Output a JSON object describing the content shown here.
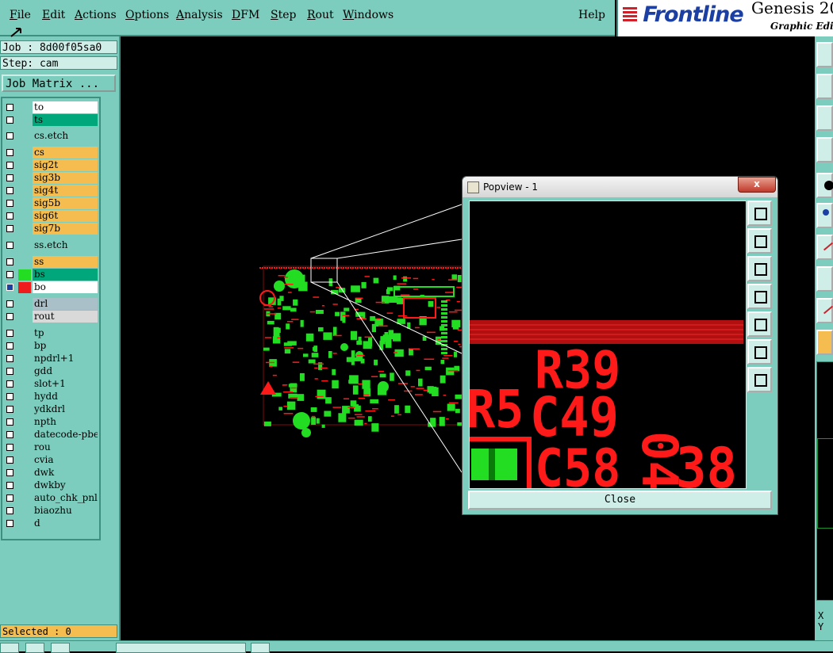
{
  "menu": {
    "items": [
      {
        "u": "F",
        "rest": "ile"
      },
      {
        "u": "E",
        "rest": "dit"
      },
      {
        "u": "A",
        "rest": "ctions"
      },
      {
        "u": "O",
        "rest": "ptions"
      },
      {
        "u": "A",
        "rest": "nalysis"
      },
      {
        "u": "D",
        "rest": "FM"
      },
      {
        "u": "S",
        "rest": "tep"
      },
      {
        "u": "R",
        "rest": "out"
      },
      {
        "u": "W",
        "rest": "indows"
      }
    ],
    "help": "Help"
  },
  "brand": {
    "logo": "Frontline",
    "product": "Genesis 20",
    "subtitle": "Graphic Edito"
  },
  "job": "Job : 8d00f05sa0",
  "step": "Step: cam",
  "job_matrix": "Job Matrix ...",
  "layers": [
    {
      "name": "to",
      "color": "#ffffff",
      "swatch": ""
    },
    {
      "name": "ts",
      "color": "#00a77a",
      "swatch": ""
    },
    {
      "name": "cs.etch",
      "color": "#7ccdbd",
      "swatch": ""
    },
    {
      "name": "cs",
      "color": "#f5bd50",
      "swatch": ""
    },
    {
      "name": "sig2t",
      "color": "#f5bd50",
      "swatch": ""
    },
    {
      "name": "sig3b",
      "color": "#f5bd50",
      "swatch": ""
    },
    {
      "name": "sig4t",
      "color": "#f5bd50",
      "swatch": ""
    },
    {
      "name": "sig5b",
      "color": "#f5bd50",
      "swatch": ""
    },
    {
      "name": "sig6t",
      "color": "#f5bd50",
      "swatch": ""
    },
    {
      "name": "sig7b",
      "color": "#f5bd50",
      "swatch": ""
    },
    {
      "name": "ss.etch",
      "color": "#7ccdbd",
      "swatch": ""
    },
    {
      "name": "ss",
      "color": "#f5bd50",
      "swatch": ""
    },
    {
      "name": "bs",
      "color": "#00a77a",
      "swatch": "#22dd22"
    },
    {
      "name": "bo",
      "color": "#ffffff",
      "swatch": "#ee1c1c"
    },
    {
      "name": "drl",
      "color": "#a9c0c8",
      "swatch": ""
    },
    {
      "name": "rout",
      "color": "#d9d9d9",
      "swatch": ""
    },
    {
      "name": "tp",
      "color": "#7ccdbd",
      "swatch": ""
    },
    {
      "name": "bp",
      "color": "#7ccdbd",
      "swatch": ""
    },
    {
      "name": "npdrl+1",
      "color": "#7ccdbd",
      "swatch": ""
    },
    {
      "name": "gdd",
      "color": "#7ccdbd",
      "swatch": ""
    },
    {
      "name": "slot+1",
      "color": "#7ccdbd",
      "swatch": ""
    },
    {
      "name": "hydd",
      "color": "#7ccdbd",
      "swatch": ""
    },
    {
      "name": "ydkdrl",
      "color": "#7ccdbd",
      "swatch": ""
    },
    {
      "name": "npth",
      "color": "#7ccdbd",
      "swatch": ""
    },
    {
      "name": "datecode-pbe",
      "color": "#7ccdbd",
      "swatch": ""
    },
    {
      "name": "rou",
      "color": "#7ccdbd",
      "swatch": ""
    },
    {
      "name": "cvia",
      "color": "#7ccdbd",
      "swatch": ""
    },
    {
      "name": "dwk",
      "color": "#7ccdbd",
      "swatch": ""
    },
    {
      "name": "dwkby",
      "color": "#7ccdbd",
      "swatch": ""
    },
    {
      "name": "auto_chk_pnl",
      "color": "#7ccdbd",
      "swatch": ""
    },
    {
      "name": "biaozhu",
      "color": "#7ccdbd",
      "swatch": ""
    },
    {
      "name": "d",
      "color": "#7ccdbd",
      "swatch": ""
    }
  ],
  "selected": "Selected : 0",
  "popview": {
    "title": "Popview - 1",
    "close_x": "x",
    "close_button": "Close",
    "tools": [
      "zoom-fit-icon",
      "pan-up-icon",
      "pan-down-icon",
      "pan-left-icon",
      "pan-right-icon",
      "zoom-out-icon",
      "zoom-in-icon"
    ]
  },
  "zoom_text": [
    "R39",
    "R5",
    "C49",
    "C58",
    "38",
    "04"
  ],
  "coord_labels": [
    "X",
    "Y"
  ],
  "colors": {
    "panel": "#7ccdbd",
    "pad": "#22dd22",
    "silk": "#ee1c1c",
    "orange": "#f5bd50",
    "accent": "#00a77a"
  }
}
